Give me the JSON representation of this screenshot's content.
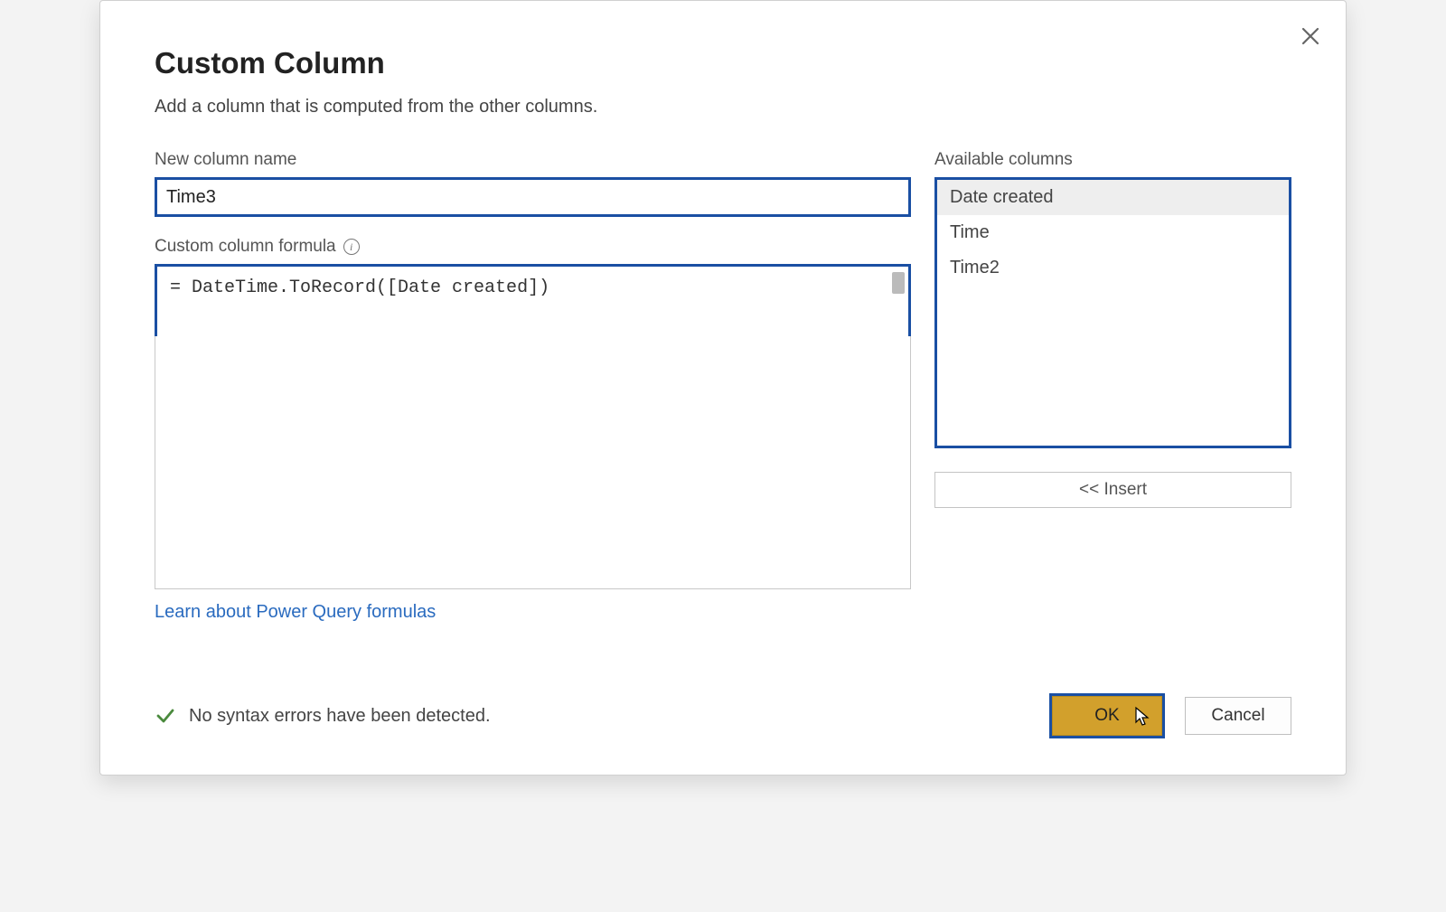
{
  "dialog": {
    "title": "Custom Column",
    "description": "Add a column that is computed from the other columns.",
    "close_label": "Close"
  },
  "fields": {
    "name_label": "New column name",
    "name_value": "Time3",
    "formula_label": "Custom column formula",
    "formula_value": "= DateTime.ToRecord([Date created])"
  },
  "available": {
    "label": "Available columns",
    "items": [
      "Date created",
      "Time",
      "Time2"
    ],
    "selected_index": 0,
    "insert_label": "<< Insert"
  },
  "link": {
    "text": "Learn about Power Query formulas"
  },
  "status": {
    "text": "No syntax errors have been detected."
  },
  "buttons": {
    "ok": "OK",
    "cancel": "Cancel"
  }
}
